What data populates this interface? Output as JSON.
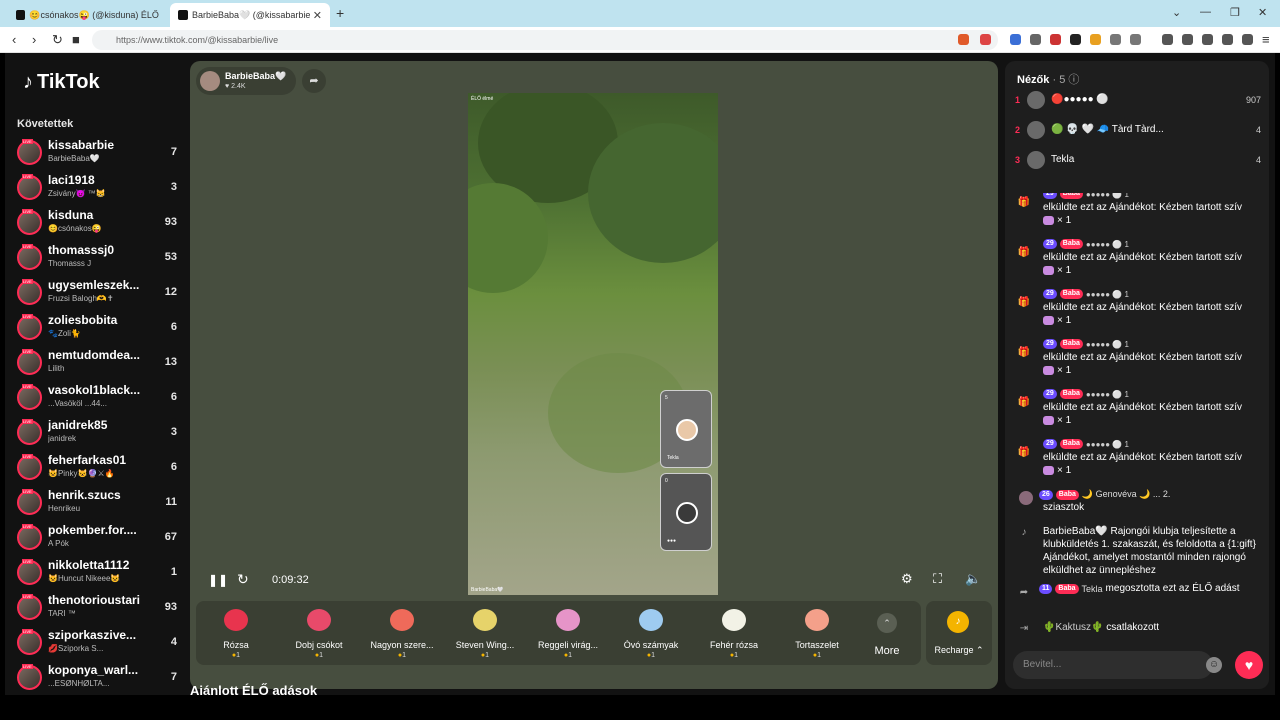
{
  "browser": {
    "tabs": [
      {
        "title": "😊csónakos😜 (@kisduna) ÉLŐ"
      },
      {
        "title": "BarbieBaba🤍 (@kissabarbie"
      }
    ],
    "url": "https://www.tiktok.com/@kissabarbie/live"
  },
  "sidebar": {
    "logo": "TikTok",
    "following_header": "Követettek",
    "items": [
      {
        "name": "kissabarbie",
        "sub": "BarbieBaba🤍",
        "count": "7"
      },
      {
        "name": "laci1918",
        "sub": "Zsivány😈 ™😸",
        "count": "3"
      },
      {
        "name": "kisduna",
        "sub": "😊csónakos😜",
        "count": "93"
      },
      {
        "name": "thomasssj0",
        "sub": "Thomasss J",
        "count": "53"
      },
      {
        "name": "ugysemleszek...",
        "sub": "Fruzsi Balogh🫶✝",
        "count": "12"
      },
      {
        "name": "zoliesbobita",
        "sub": "🐾Zoli🐈",
        "count": "6"
      },
      {
        "name": "nemtudomdea...",
        "sub": "Lilith",
        "count": "13"
      },
      {
        "name": "vasokol1black...",
        "sub": "...Vasököl ...44...",
        "count": "6"
      },
      {
        "name": "janidrek85",
        "sub": "janidrek",
        "count": "3"
      },
      {
        "name": "feherfarkas01",
        "sub": "😺Pinky😺🔮⚔🔥",
        "count": "6"
      },
      {
        "name": "henrik.szucs",
        "sub": "Henrikeu",
        "count": "11"
      },
      {
        "name": "pokember.for....",
        "sub": "A Pók",
        "count": "67"
      },
      {
        "name": "nikkoletta1112",
        "sub": "😺Huncut Nikeee😺",
        "count": "1"
      },
      {
        "name": "thenotorioustari",
        "sub": "TARI ™",
        "count": "93"
      },
      {
        "name": "sziporkaszive...",
        "sub": "💋Sziporka S...",
        "count": "4"
      },
      {
        "name": "koponya_warl...",
        "sub": "...ESØNHØLTA...",
        "count": "7"
      }
    ]
  },
  "stream": {
    "host_name": "BarbieBaba🤍",
    "host_likes": "♥ 2.4K",
    "time": "0:09:32",
    "guests": [
      {
        "count": "5",
        "name": "Tekla"
      },
      {
        "count": "0",
        "name": "●●●"
      }
    ],
    "watermark_top": "ÉLŐ élmé",
    "watermark_bottom": "BarbieBaba🤍"
  },
  "gifts": [
    {
      "name": "Rózsa",
      "price": "1",
      "color": "#e8344e"
    },
    {
      "name": "Dobj csókot",
      "price": "1",
      "color": "#e84a6a"
    },
    {
      "name": "Nagyon szere...",
      "price": "1",
      "color": "#ef6a5a"
    },
    {
      "name": "Steven Wing...",
      "price": "1",
      "color": "#e6d36a"
    },
    {
      "name": "Reggeli virág...",
      "price": "1",
      "color": "#e694c8"
    },
    {
      "name": "Óvó számyak",
      "price": "1",
      "color": "#9ecbf0"
    },
    {
      "name": "Fehér rózsa",
      "price": "1",
      "color": "#f2f2e6"
    },
    {
      "name": "Tortaszelet",
      "price": "1",
      "color": "#f4a08a"
    }
  ],
  "gift_more": "More",
  "recharge": "Recharge ⌃",
  "recommended": "Ajánlott ÉLŐ adások",
  "viewers": {
    "header": "Nézők",
    "count": "· 5 ⓘ",
    "list": [
      {
        "rank": "1",
        "name": "🔴●●●●● ⚪",
        "count": "907"
      },
      {
        "rank": "2",
        "name": "🟢 💀 🤍 🧢 Tàrd Tàrd...",
        "count": "4"
      },
      {
        "rank": "3",
        "name": "Tekla",
        "count": "4"
      }
    ]
  },
  "chat": [
    {
      "icon": "🎁",
      "badges": [
        "29",
        "Baba"
      ],
      "user": "●●●●● ⚪ 1",
      "text": "elküldte ezt az Ajándékot: Kézben tartott szív",
      "qty": "× 1"
    },
    {
      "icon": "🎁",
      "badges": [
        "29",
        "Baba"
      ],
      "user": "●●●●● ⚪ 1",
      "text": "elküldte ezt az Ajándékot: Kézben tartott szív",
      "qty": "× 1"
    },
    {
      "icon": "🎁",
      "badges": [
        "29",
        "Baba"
      ],
      "user": "●●●●● ⚪ 1",
      "text": "elküldte ezt az Ajándékot: Kézben tartott szív",
      "qty": "× 1"
    },
    {
      "icon": "🎁",
      "badges": [
        "29",
        "Baba"
      ],
      "user": "●●●●● ⚪ 1",
      "text": "elküldte ezt az Ajándékot: Kézben tartott szív",
      "qty": "× 1"
    },
    {
      "icon": "🎁",
      "badges": [
        "29",
        "Baba"
      ],
      "user": "●●●●● ⚪ 1",
      "text": "elküldte ezt az Ajándékot: Kézben tartott szív",
      "qty": "× 1"
    },
    {
      "icon": "🎁",
      "badges": [
        "29",
        "Baba"
      ],
      "user": "●●●●● ⚪ 1",
      "text": "elküldte ezt az Ajándékot: Kézben tartott szív",
      "qty": "× 1"
    }
  ],
  "chat_extra": {
    "genoveva_badges": [
      "26",
      "Baba"
    ],
    "genoveva_user": "🌙 Genovéva 🌙 ... 2.",
    "genoveva_text": "sziasztok",
    "system_text": "BarbieBaba🤍 Rajongói klubja teljesítette a klubküldetés 1. szakaszát, és feloldotta a {1:gift} Ajándékot, amelyet mostantól minden rajongó elküldhet az ünnepléshez",
    "share_badges": [
      "11",
      "Baba"
    ],
    "share_user": "Tekla",
    "share_text": "megosztotta ezt az ÉLŐ adást",
    "join_user": "🌵Kaktusz🌵",
    "join_text": "csatlakozott"
  },
  "input_placeholder": "Bevitel..."
}
